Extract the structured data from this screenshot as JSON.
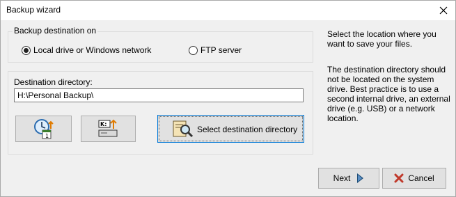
{
  "window": {
    "title": "Backup wizard",
    "close_icon": "close-icon"
  },
  "destination_group": {
    "legend": "Backup destination on",
    "options": [
      {
        "label": "Local drive or Windows network",
        "selected": true
      },
      {
        "label": "FTP server",
        "selected": false
      }
    ]
  },
  "directory_group": {
    "label": "Destination directory:",
    "value": "H:\\Personal Backup\\",
    "buttons": [
      {
        "icon": "schedule-calendar-icon"
      },
      {
        "icon": "drive-k-icon"
      }
    ],
    "select_button": {
      "label": "Select destination directory",
      "icon": "search-folder-icon"
    }
  },
  "help": {
    "para1": "Select the location where you\nwant to save your files.",
    "para2": "The destination directory should\nnot be located on the system\ndrive. Best practice is to use a\nsecond internal drive, an external\ndrive (e.g. USB) or a network\nlocation."
  },
  "footer": {
    "next_label": "Next",
    "cancel_label": "Cancel"
  },
  "colors": {
    "window_bg": "#f0f0f0",
    "button_bg": "#e1e1e1",
    "focus_border": "#0078d7",
    "cancel_icon": "#c0392b",
    "next_arrow": "#1f4e79"
  }
}
